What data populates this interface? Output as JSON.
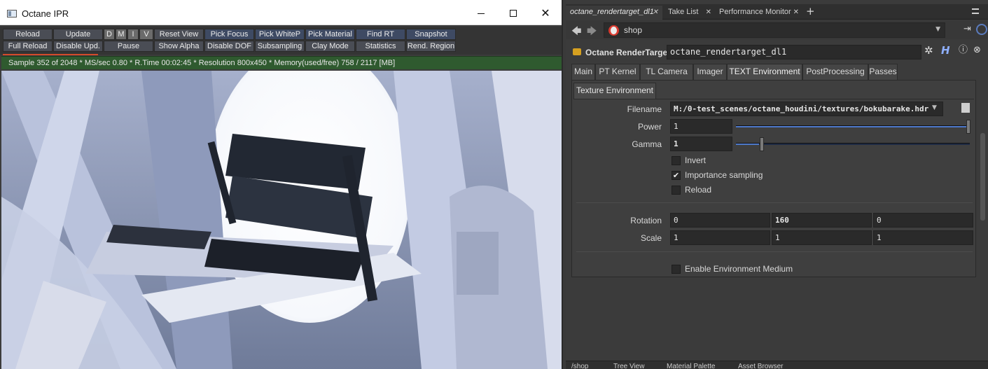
{
  "ipr": {
    "title": "Octane IPR",
    "toolbar_row1": [
      "Reload",
      "Update",
      "D",
      "M",
      "I",
      "V",
      "Reset View",
      "Pick Focus",
      "Pick WhiteP",
      "Pick Material",
      "Find RT",
      "Snapshot"
    ],
    "toolbar_row2": [
      "Full Reload",
      "Disable Upd.",
      "Pause",
      "Show Alpha",
      "Disable DOF",
      "Subsampling",
      "Clay Mode",
      "Statistics",
      "Rend. Region"
    ],
    "status": "Sample 352 of 2048 * MS/sec 0.80 * R.Time 00:02:45 * Resolution 800x450 * Memory(used/free) 758 / 2117 [MB]",
    "progress": 0.172
  },
  "houdini": {
    "tabs": [
      "octane_rendertarget_dl1",
      "Take List",
      "Performance Monitor"
    ],
    "path": "shop",
    "node_type": "Octane RenderTarget",
    "node_name": "octane_rendertarget_dl1",
    "param_tabs": [
      "Main",
      "PT Kernel",
      "TL Camera",
      "Imager",
      "TEXT Environment",
      "PostProcessing",
      "Passes"
    ],
    "active_param_tab": "TEXT Environment",
    "subtab": "Texture Environment",
    "params": {
      "filename_label": "Filename",
      "filename": "M:/0-test_scenes/octane_houdini/textures/bokubarake.hdr",
      "power_label": "Power",
      "power": "1",
      "power_slider": 1.0,
      "gamma_label": "Gamma",
      "gamma": "1",
      "gamma_slider": 0.1,
      "invert_label": "Invert",
      "invert": false,
      "importance_label": "Importance sampling",
      "importance": true,
      "reload_label": "Reload",
      "reload": false,
      "rotation_label": "Rotation",
      "rotation": [
        "0",
        "160",
        "0"
      ],
      "scale_label": "Scale",
      "scale": [
        "1",
        "1",
        "1"
      ],
      "medium_label": "Enable Environment Medium",
      "medium": false
    },
    "bottom_tabs": [
      "/shop",
      "Tree View",
      "Material Palette",
      "Asset Browser"
    ]
  },
  "colors": {
    "status_bg": "#2f5a2f",
    "progress": "#d34b2b",
    "slider": "#4d78c9",
    "panel_bg": "#3b3b3b"
  }
}
